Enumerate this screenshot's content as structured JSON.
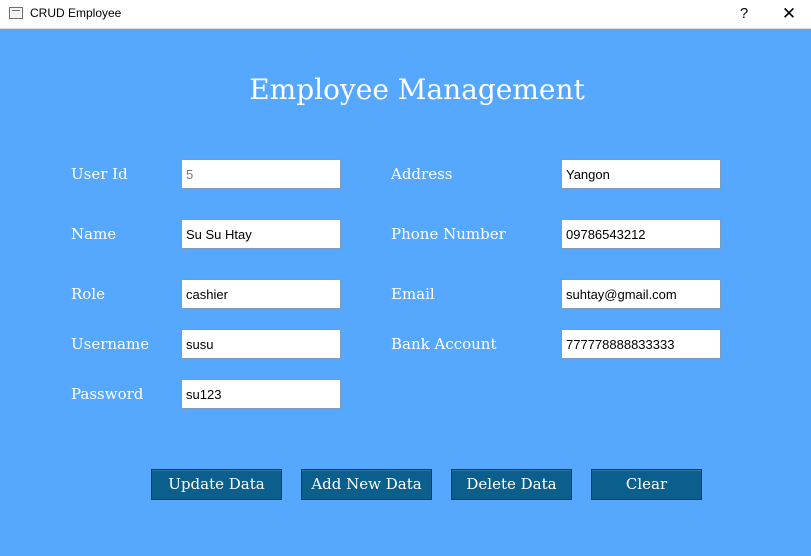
{
  "window": {
    "title": "CRUD Employee",
    "help_glyph": "?",
    "close_glyph": "✕"
  },
  "form": {
    "heading": "Employee Management",
    "fields": {
      "user_id": {
        "label": "User Id",
        "value": "5"
      },
      "name": {
        "label": "Name",
        "value": "Su Su Htay"
      },
      "role": {
        "label": "Role",
        "value": "cashier"
      },
      "username": {
        "label": "Username",
        "value": "susu"
      },
      "password": {
        "label": "Password",
        "value": "su123"
      },
      "address": {
        "label": "Address",
        "value": "Yangon"
      },
      "phone": {
        "label": "Phone Number",
        "value": "09786543212"
      },
      "email": {
        "label": "Email",
        "value": "suhtay@gmail.com"
      },
      "bank": {
        "label": "Bank Account",
        "value": "777778888833333"
      }
    }
  },
  "buttons": {
    "update": "Update Data",
    "add": "Add New Data",
    "delete": "Delete Data",
    "clear": "Clear"
  },
  "colors": {
    "background": "#55a8fe",
    "button": "#0b5f8c",
    "text": "#ffffff"
  }
}
